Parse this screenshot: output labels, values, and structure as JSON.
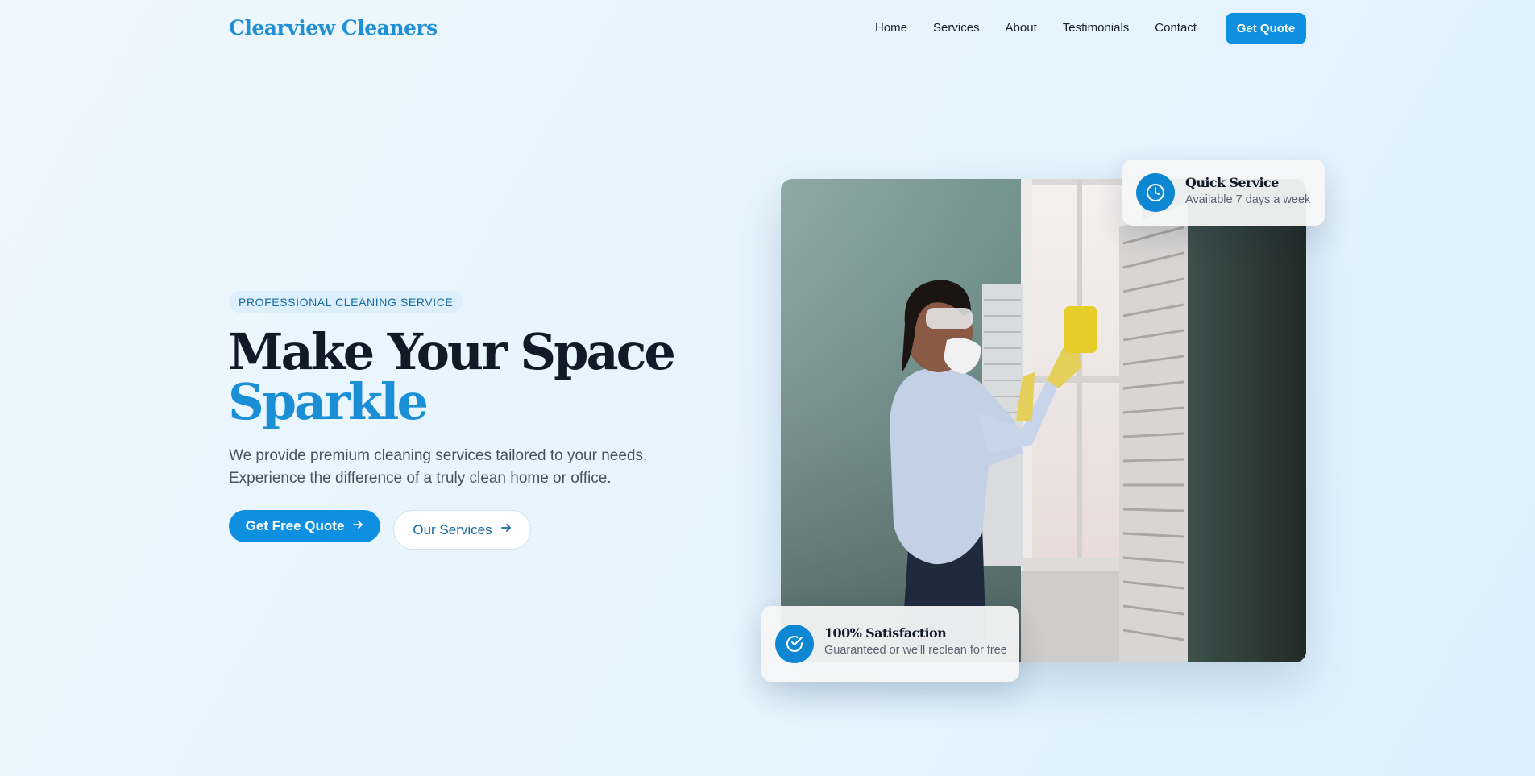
{
  "brand": {
    "name": "Clearview Cleaners",
    "accent_color": "#0e8fdf"
  },
  "nav": {
    "links": [
      "Home",
      "Services",
      "About",
      "Testimonials",
      "Contact"
    ],
    "cta": "Get Quote"
  },
  "hero": {
    "badge": "PROFESSIONAL CLEANING SERVICE",
    "headline_line1": "Make Your Space",
    "headline_accent": "Sparkle",
    "lead": "We provide premium cleaning services tailored to your needs. Experience the difference of a truly clean home or office.",
    "primary_button": "Get Free Quote",
    "secondary_button": "Our Services",
    "arrow_icon": "arrow-right-icon"
  },
  "cards": {
    "quick": {
      "title": "Quick Service",
      "subtitle": "Available 7 days a week",
      "icon": "clock-icon"
    },
    "satisfaction": {
      "title": "100% Satisfaction",
      "subtitle": "Guaranteed or we'll reclean for free",
      "icon": "check-circle-icon"
    }
  }
}
